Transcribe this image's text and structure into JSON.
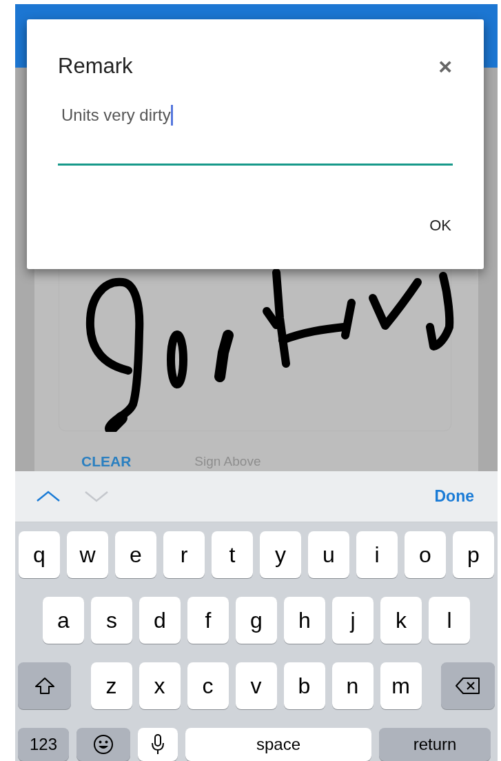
{
  "dialog": {
    "title": "Remark",
    "close": "×",
    "field": {
      "value": "Units very dirty",
      "focused": true
    },
    "ok": "OK"
  },
  "signature_pad": {
    "clear": "CLEAR",
    "hint": "Sign Above"
  },
  "keyboard": {
    "nav": [
      {
        "kind": "up",
        "disabled": false
      },
      {
        "kind": "down",
        "disabled": true
      }
    ],
    "done": "Done",
    "rows": [
      [
        {
          "kind": "letter",
          "label": "q"
        },
        {
          "kind": "letter",
          "label": "w"
        },
        {
          "kind": "letter",
          "label": "e"
        },
        {
          "kind": "letter",
          "label": "r"
        },
        {
          "kind": "letter",
          "label": "t"
        },
        {
          "kind": "letter",
          "label": "y"
        },
        {
          "kind": "letter",
          "label": "u"
        },
        {
          "kind": "letter",
          "label": "i"
        },
        {
          "kind": "letter",
          "label": "o"
        },
        {
          "kind": "letter",
          "label": "p"
        }
      ],
      [
        {
          "kind": "letter",
          "label": "a"
        },
        {
          "kind": "letter",
          "label": "s"
        },
        {
          "kind": "letter",
          "label": "d"
        },
        {
          "kind": "letter",
          "label": "f"
        },
        {
          "kind": "letter",
          "label": "g"
        },
        {
          "kind": "letter",
          "label": "h"
        },
        {
          "kind": "letter",
          "label": "j"
        },
        {
          "kind": "letter",
          "label": "k"
        },
        {
          "kind": "letter",
          "label": "l"
        }
      ],
      [
        {
          "kind": "shift"
        },
        {
          "kind": "letter",
          "label": "z"
        },
        {
          "kind": "letter",
          "label": "x"
        },
        {
          "kind": "letter",
          "label": "c"
        },
        {
          "kind": "letter",
          "label": "v"
        },
        {
          "kind": "letter",
          "label": "b"
        },
        {
          "kind": "letter",
          "label": "n"
        },
        {
          "kind": "letter",
          "label": "m"
        },
        {
          "kind": "delete"
        }
      ]
    ],
    "bottom_row": [
      {
        "kind": "numbers",
        "label": "123"
      },
      {
        "kind": "emoji"
      },
      {
        "kind": "mic"
      },
      {
        "kind": "space",
        "label": "space"
      },
      {
        "kind": "return",
        "label": "return"
      }
    ]
  }
}
